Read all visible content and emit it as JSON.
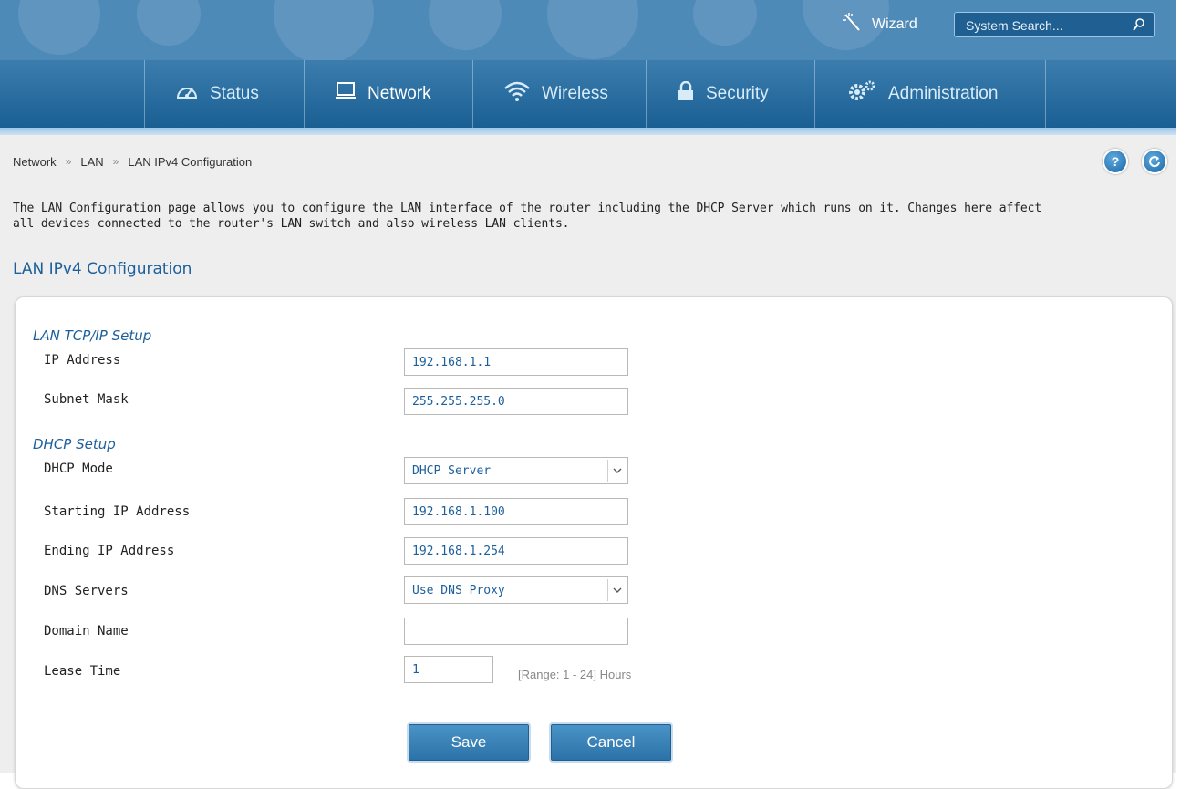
{
  "header": {
    "wizard_label": "Wizard",
    "search_placeholder": "System Search...",
    "nav": [
      {
        "label": "Status",
        "icon": "gauge-icon"
      },
      {
        "label": "Network",
        "icon": "computer-icon"
      },
      {
        "label": "Wireless",
        "icon": "wifi-icon"
      },
      {
        "label": "Security",
        "icon": "lock-icon"
      },
      {
        "label": "Administration",
        "icon": "gears-icon"
      }
    ],
    "active_tab": "Network"
  },
  "breadcrumb": [
    "Network",
    "LAN",
    "LAN IPv4 Configuration"
  ],
  "breadcrumb_separator": "»",
  "help_icons": [
    "help-icon",
    "refresh-icon"
  ],
  "help_button_label": "?",
  "description_lines": [
    "The LAN Configuration page allows you to configure the LAN interface of the router including the DHCP Server which runs on it. Changes here affect",
    "all devices connected to the router's LAN switch and also wireless LAN clients."
  ],
  "section_title": "LAN IPv4 Configuration",
  "lan_setup": {
    "title": "LAN TCP/IP Setup",
    "ip_address_label": "IP Address",
    "ip_address_value": "192.168.1.1",
    "subnet_mask_label": "Subnet Mask",
    "subnet_mask_value": "255.255.255.0"
  },
  "dhcp_setup": {
    "title": "DHCP Setup",
    "mode_label": "DHCP Mode",
    "mode_value": "DHCP Server",
    "start_ip_label": "Starting IP Address",
    "start_ip_value": "192.168.1.100",
    "end_ip_label": "Ending IP Address",
    "end_ip_value": "192.168.1.254",
    "dns_label": "DNS Servers",
    "dns_value": "Use DNS Proxy",
    "domain_label": "Domain Name",
    "domain_value": "",
    "lease_label": "Lease Time",
    "lease_value": "1",
    "lease_hint": "[Range: 1 - 24] Hours"
  },
  "buttons": {
    "save": "Save",
    "cancel": "Cancel"
  },
  "colors": {
    "brand_blue": "#1a5f93",
    "accent_text": "#1c5f9b",
    "content_bg": "#eeeeee"
  }
}
